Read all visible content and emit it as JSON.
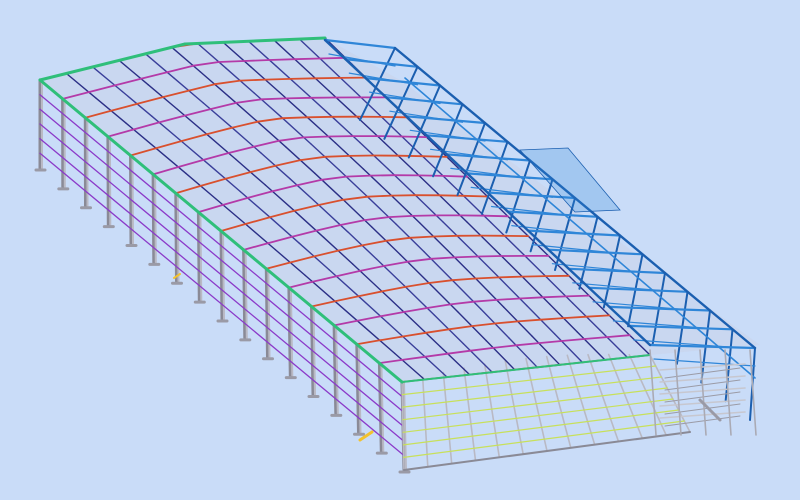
{
  "viewport": {
    "background": "#c9dcf8",
    "content": "steel-frame-building-3d-model"
  },
  "colors": {
    "column": "#b9b9c4",
    "column_edge": "#8a8a96",
    "girt_side": "#8b3ac9",
    "girt_end": "#c8e05a",
    "purlin": "#2b2f86",
    "rafter_a": "#d9502e",
    "rafter_b": "#b43aa8",
    "eave": "#2fbf7a",
    "ridge": "#e07a3a",
    "annex_frame": "#2f86d8",
    "annex_dark": "#1b5fb0",
    "stair": "#c7c7cf",
    "accent_yellow": "#f2c22e"
  },
  "model": {
    "bays_long": 16,
    "bays_wide": 11,
    "annex_bays": 16
  }
}
